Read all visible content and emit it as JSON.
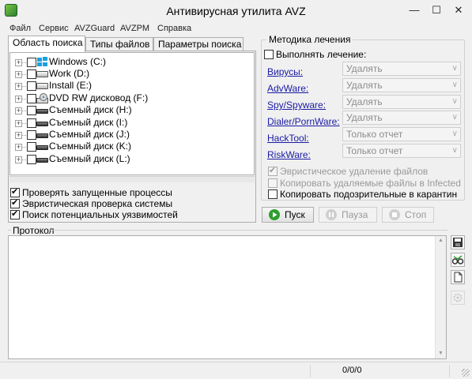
{
  "window": {
    "title": "Антивирусная утилита AVZ",
    "minimize": "—",
    "maximize": "☐",
    "close": "✕"
  },
  "menu": [
    "Файл",
    "Сервис",
    "AVZGuard",
    "AVZPM",
    "Справка"
  ],
  "tabs": [
    "Область поиска",
    "Типы файлов",
    "Параметры поиска"
  ],
  "drives": [
    {
      "label": "Windows (C:)",
      "icon": "windows-drive-icon"
    },
    {
      "label": "Work (D:)",
      "icon": "hard-drive-icon"
    },
    {
      "label": "Install (E:)",
      "icon": "hard-drive-icon"
    },
    {
      "label": "DVD RW дисковод (F:)",
      "icon": "dvd-drive-icon"
    },
    {
      "label": "Съемный диск (H:)",
      "icon": "removable-drive-icon"
    },
    {
      "label": "Съемный диск (I:)",
      "icon": "removable-drive-icon"
    },
    {
      "label": "Съемный диск (J:)",
      "icon": "removable-drive-icon"
    },
    {
      "label": "Съемный диск (K:)",
      "icon": "removable-drive-icon"
    },
    {
      "label": "Съемный диск (L:)",
      "icon": "removable-drive-icon"
    }
  ],
  "scan_options": [
    {
      "label": "Проверять запущенные процессы",
      "checked": true
    },
    {
      "label": "Эвристическая проверка системы",
      "checked": true
    },
    {
      "label": "Поиск потенциальных уязвимостей",
      "checked": true
    }
  ],
  "treatment": {
    "title": "Методика лечения",
    "enable_label": "Выполнять лечение:",
    "enabled": false,
    "rows": [
      {
        "label": "Вирусы:",
        "value": "Удалять"
      },
      {
        "label": "AdvWare:",
        "value": "Удалять"
      },
      {
        "label": "Spy/Spyware:",
        "value": "Удалять"
      },
      {
        "label": "Dialer/PornWare:",
        "value": "Удалять"
      },
      {
        "label": "HackTool:",
        "value": "Только отчет"
      },
      {
        "label": "RiskWare:",
        "value": "Только отчет"
      }
    ],
    "heuristic_delete": "Эвристическое удаление файлов",
    "copy_deleted": "Копировать удаляемые файлы в  Infected",
    "copy_suspicious": "Копировать подозрительные в  карантин"
  },
  "buttons": {
    "start": "Пуск",
    "pause": "Пауза",
    "stop": "Стоп"
  },
  "log": {
    "title": "Протокол"
  },
  "status": {
    "counter": "0/0/0"
  },
  "colors": {
    "link": "#1a1aa6",
    "start_icon": "#2e9e2e",
    "disabled_text": "#9a9a9a"
  }
}
